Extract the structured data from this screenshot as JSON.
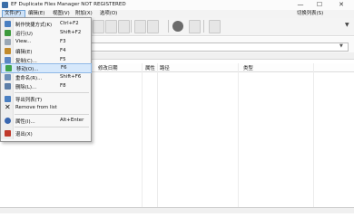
{
  "window": {
    "title": "EF Duplicate Files Manager NOT REGISTERED",
    "controls": {
      "minimize": "—",
      "maximize": "☐",
      "close": "✕"
    }
  },
  "menubar": {
    "file": "文件(F)",
    "edit": "编辑(E)",
    "view": "视图(V)",
    "tools": "附加(X)",
    "options": "选项(O)",
    "switch_list": "切换列表(S)"
  },
  "columns": {
    "modified": "修改日期",
    "attr": "属性",
    "path": "路径",
    "type": "类型"
  },
  "file_menu": {
    "items": [
      {
        "label": "制作快捷方式(K)",
        "shortcut": "Ctrl+F2",
        "icon": "shortcut-icon",
        "color": "#4a7fc1"
      },
      {
        "label": "运行(U)",
        "shortcut": "Shift+F2",
        "icon": "run-icon",
        "color": "#3c9a3c"
      },
      {
        "label": "View...",
        "shortcut": "F3",
        "icon": "view-icon",
        "color": "#9aa7b4"
      },
      {
        "label": "编辑(E)",
        "shortcut": "F4",
        "icon": "edit-icon",
        "color": "#c28a2b"
      },
      {
        "label": "复制(C)...",
        "shortcut": "F5",
        "icon": "copy-icon",
        "color": "#5a86c4"
      },
      {
        "label": "移动(O)...",
        "shortcut": "F6",
        "icon": "move-icon",
        "color": "#3fa34d"
      },
      {
        "label": "重命名(R)...",
        "shortcut": "Shift+F6",
        "icon": "rename-icon",
        "color": "#6c8fb8"
      },
      {
        "label": "删除(L)...",
        "shortcut": "F8",
        "icon": "delete-icon",
        "color": "#5c7ea8"
      },
      {
        "label": "导出列表(T)",
        "shortcut": "",
        "icon": "export-icon",
        "color": "#4a7fc1"
      },
      {
        "label": "Remove from list",
        "shortcut": "",
        "icon": "remove-icon",
        "color": "#d23a2a"
      },
      {
        "label": "属性(I)...",
        "shortcut": "Alt+Enter",
        "icon": "info-icon",
        "color": "#3a67b0"
      },
      {
        "label": "退出(X)",
        "shortcut": "",
        "icon": "exit-icon",
        "color": "#c0392b"
      }
    ]
  }
}
